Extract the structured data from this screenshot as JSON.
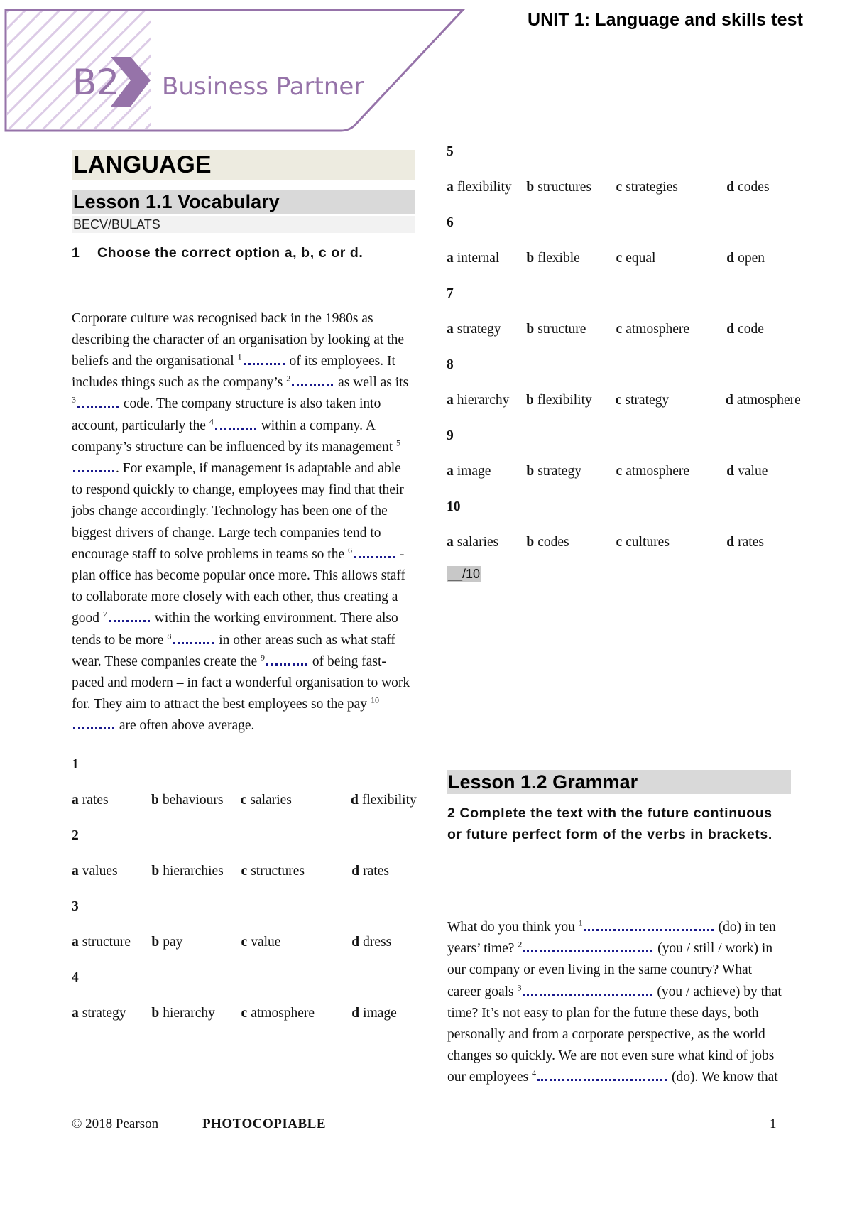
{
  "header": {
    "logo_level": "B2",
    "logo_name": "Business Partner",
    "unit_title": "UNIT 1: Language and skills test",
    "brand_color": "#9673a9"
  },
  "section": {
    "title": "LANGUAGE"
  },
  "lesson1": {
    "title": "Lesson 1.1 Vocabulary",
    "exam_tag": "BECV/BULATS",
    "exercise_number": "1",
    "instruction": "Choose the correct option a, b, c or d.",
    "passage": [
      {
        "text": "Corporate culture was recognised back in the 1980s as describing the character of an organisation by looking at the beliefs and the organisational ",
        "gap": "1"
      },
      {
        "text": " of its employees. It includes things such as the company’s ",
        "gap": "2"
      },
      {
        "text": " as well as its ",
        "gap": "3"
      },
      {
        "text": " code. The company structure is also taken into account, particularly the ",
        "gap": "4"
      },
      {
        "text": " within a company. A company’s structure can be influenced by its management ",
        "gap": "5"
      },
      {
        "text": ". For example, if management is adaptable and able to respond quickly to change, employees may find that their jobs change accordingly. Technology has been one of the biggest drivers of change. Large tech companies tend to encourage staff to solve problems in teams so the ",
        "gap": "6"
      },
      {
        "text": " -plan office has become popular once more. This allows staff to collaborate more closely with each other, thus creating a good ",
        "gap": "7"
      },
      {
        "text": " within the working environment. There also tends to be more ",
        "gap": "8"
      },
      {
        "text": " in other areas such as what staff wear. These companies create the ",
        "gap": "9"
      },
      {
        "text": " of being fast-paced and modern – in fact a wonderful organisation to work for. They aim to attract the best employees so the pay ",
        "gap": "10"
      },
      {
        "text": " are often above average.",
        "gap": null
      }
    ],
    "questions": [
      {
        "number": "1",
        "options": [
          {
            "letter": "a",
            "text": "rates"
          },
          {
            "letter": "b",
            "text": "behaviours"
          },
          {
            "letter": "c",
            "text": "salaries"
          },
          {
            "letter": "d",
            "text": "flexibility"
          }
        ]
      },
      {
        "number": "2",
        "options": [
          {
            "letter": "a",
            "text": "values"
          },
          {
            "letter": "b",
            "text": "hierarchies"
          },
          {
            "letter": "c",
            "text": "structures"
          },
          {
            "letter": "d",
            "text": "rates"
          }
        ]
      },
      {
        "number": "3",
        "options": [
          {
            "letter": "a",
            "text": "structure"
          },
          {
            "letter": "b",
            "text": "pay"
          },
          {
            "letter": "c",
            "text": "value"
          },
          {
            "letter": "d",
            "text": "dress"
          }
        ]
      },
      {
        "number": "4",
        "options": [
          {
            "letter": "a",
            "text": "strategy"
          },
          {
            "letter": "b",
            "text": "hierarchy"
          },
          {
            "letter": "c",
            "text": "atmosphere"
          },
          {
            "letter": "d",
            "text": "image"
          }
        ]
      },
      {
        "number": "5",
        "options": [
          {
            "letter": "a",
            "text": "flexibility"
          },
          {
            "letter": "b",
            "text": "structures"
          },
          {
            "letter": "c",
            "text": "strategies"
          },
          {
            "letter": "d",
            "text": "codes"
          }
        ]
      },
      {
        "number": "6",
        "options": [
          {
            "letter": "a",
            "text": "internal"
          },
          {
            "letter": "b",
            "text": "flexible"
          },
          {
            "letter": "c",
            "text": "equal"
          },
          {
            "letter": "d",
            "text": "open"
          }
        ]
      },
      {
        "number": "7",
        "options": [
          {
            "letter": "a",
            "text": "strategy"
          },
          {
            "letter": "b",
            "text": "structure"
          },
          {
            "letter": "c",
            "text": "atmosphere"
          },
          {
            "letter": "d",
            "text": "code"
          }
        ]
      },
      {
        "number": "8",
        "options": [
          {
            "letter": "a",
            "text": "hierarchy"
          },
          {
            "letter": "b",
            "text": "flexibility"
          },
          {
            "letter": "c",
            "text": "strategy"
          },
          {
            "letter": "d",
            "text": "atmosphere"
          }
        ]
      },
      {
        "number": "9",
        "options": [
          {
            "letter": "a",
            "text": "image"
          },
          {
            "letter": "b",
            "text": "strategy"
          },
          {
            "letter": "c",
            "text": "atmosphere"
          },
          {
            "letter": "d",
            "text": "value"
          }
        ]
      },
      {
        "number": "10",
        "options": [
          {
            "letter": "a",
            "text": "salaries"
          },
          {
            "letter": "b",
            "text": "codes"
          },
          {
            "letter": "c",
            "text": "cultures"
          },
          {
            "letter": "d",
            "text": "rates"
          }
        ]
      }
    ],
    "score": "__/10"
  },
  "lesson2": {
    "title": "Lesson 1.2 Grammar",
    "instruction": "2 Complete the text with the future continuous or future perfect form of the verbs in brackets.",
    "passage": [
      {
        "text": "What do you think you ",
        "gap": "1"
      },
      {
        "text": " (do) in ten years’ time? ",
        "gap": "2"
      },
      {
        "text": " (you / still / work) in our company or even living in the same country? What career goals ",
        "gap": "3"
      },
      {
        "text": " (you / achieve) by that time? It’s not easy to plan for the future these days, both personally and from a corporate perspective, as the world changes so quickly. We are not even sure what kind of jobs our employees ",
        "gap": "4"
      },
      {
        "text": " (do). We know that",
        "gap": null
      }
    ]
  },
  "footer": {
    "copyright": "© 2018 Pearson",
    "photocopiable": "PHOTOCOPIABLE",
    "page_number": "1"
  }
}
